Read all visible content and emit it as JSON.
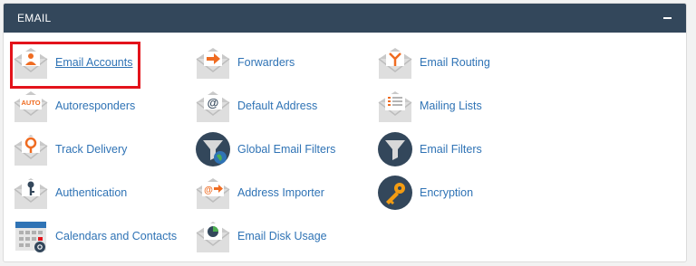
{
  "section": {
    "title": "EMAIL",
    "collapse_icon": "minus-icon"
  },
  "colors": {
    "header_bg": "#33475b",
    "link": "#2f73b5",
    "envelope_accent": "#ef6c22",
    "highlight": "#e3131b"
  },
  "items": [
    {
      "label": "Email Accounts",
      "icon": "email-accounts-icon",
      "highlighted": true
    },
    {
      "label": "Forwarders",
      "icon": "forwarders-icon"
    },
    {
      "label": "Email Routing",
      "icon": "email-routing-icon"
    },
    {
      "label": "Autoresponders",
      "icon": "autoresponders-icon"
    },
    {
      "label": "Default Address",
      "icon": "default-address-icon"
    },
    {
      "label": "Mailing Lists",
      "icon": "mailing-lists-icon"
    },
    {
      "label": "Track Delivery",
      "icon": "track-delivery-icon"
    },
    {
      "label": "Global Email Filters",
      "icon": "global-email-filters-icon"
    },
    {
      "label": "Email Filters",
      "icon": "email-filters-icon"
    },
    {
      "label": "Authentication",
      "icon": "authentication-icon"
    },
    {
      "label": "Address Importer",
      "icon": "address-importer-icon"
    },
    {
      "label": "Encryption",
      "icon": "encryption-icon"
    },
    {
      "label": "Calendars and Contacts",
      "icon": "calendars-contacts-icon"
    },
    {
      "label": "Email Disk Usage",
      "icon": "email-disk-usage-icon"
    }
  ],
  "icon_text": {
    "auto": "AUTO",
    "at": "@"
  }
}
